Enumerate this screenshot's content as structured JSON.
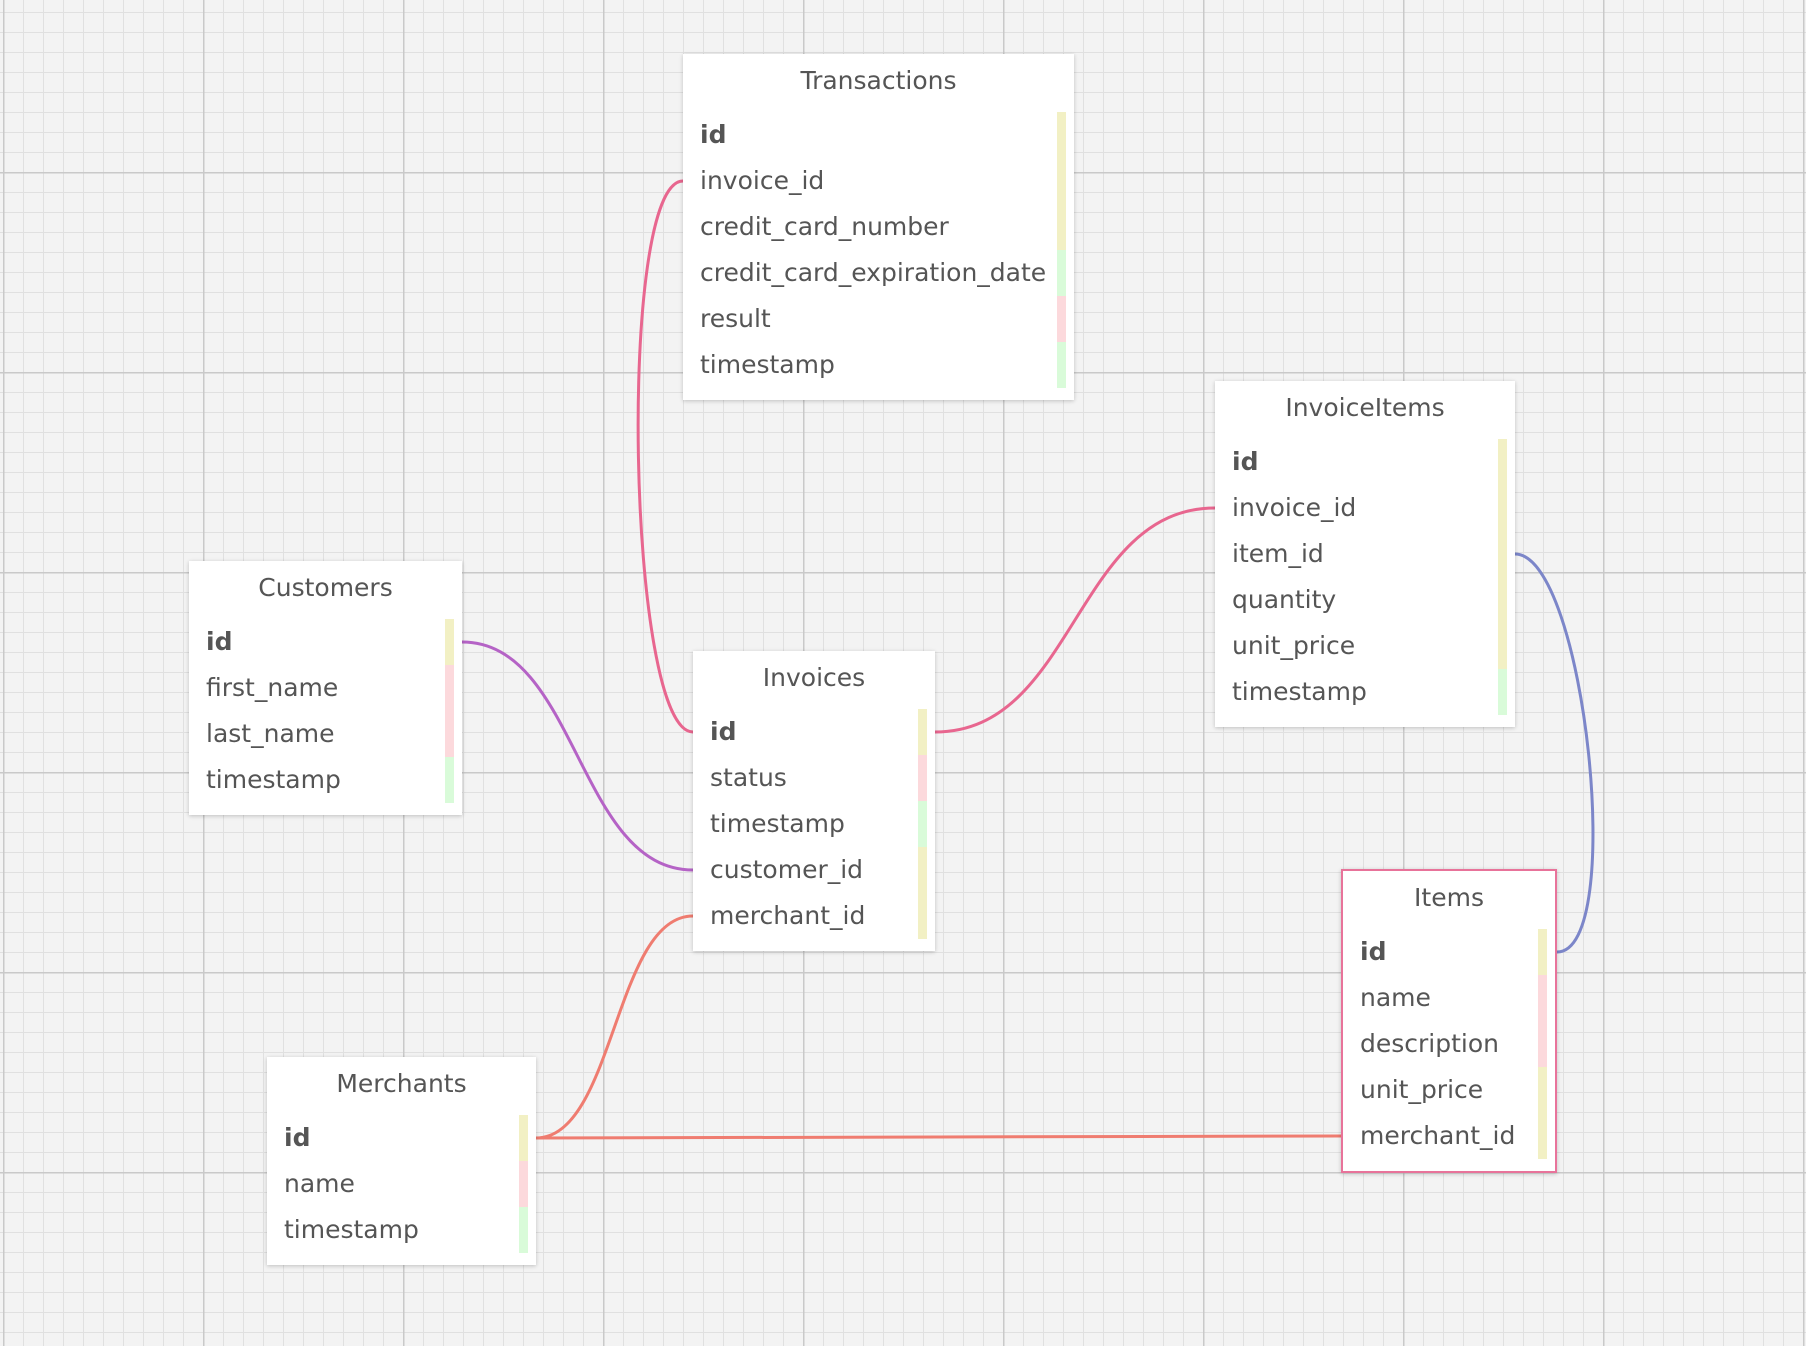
{
  "type_colors": {
    "integer": "#f2f0c4",
    "string": "#fcd9dc",
    "timestamp": "#d9fbd9"
  },
  "tables": [
    {
      "id": "transactions",
      "title": "Transactions",
      "fields": [
        {
          "name": "id",
          "key": true,
          "type": "integer"
        },
        {
          "name": "invoice_id",
          "type": "integer"
        },
        {
          "name": "credit_card_number",
          "type": "integer"
        },
        {
          "name": "credit_card_expiration_date",
          "type": "timestamp"
        },
        {
          "name": "result",
          "type": "string"
        },
        {
          "name": "timestamp",
          "type": "timestamp"
        }
      ]
    },
    {
      "id": "invoiceitems",
      "title": "InvoiceItems",
      "fields": [
        {
          "name": "id",
          "key": true,
          "type": "integer"
        },
        {
          "name": "invoice_id",
          "type": "integer"
        },
        {
          "name": "item_id",
          "type": "integer"
        },
        {
          "name": "quantity",
          "type": "integer"
        },
        {
          "name": "unit_price",
          "type": "integer"
        },
        {
          "name": "timestamp",
          "type": "timestamp"
        }
      ]
    },
    {
      "id": "customers",
      "title": "Customers",
      "fields": [
        {
          "name": "id",
          "key": true,
          "type": "integer"
        },
        {
          "name": "first_name",
          "type": "string"
        },
        {
          "name": "last_name",
          "type": "string"
        },
        {
          "name": "timestamp",
          "type": "timestamp"
        }
      ]
    },
    {
      "id": "invoices",
      "title": "Invoices",
      "fields": [
        {
          "name": "id",
          "key": true,
          "type": "integer"
        },
        {
          "name": "status",
          "type": "string"
        },
        {
          "name": "timestamp",
          "type": "timestamp"
        },
        {
          "name": "customer_id",
          "type": "integer"
        },
        {
          "name": "merchant_id",
          "type": "integer"
        }
      ]
    },
    {
      "id": "items",
      "title": "Items",
      "selected": true,
      "fields": [
        {
          "name": "id",
          "key": true,
          "type": "integer"
        },
        {
          "name": "name",
          "type": "string"
        },
        {
          "name": "description",
          "type": "string"
        },
        {
          "name": "unit_price",
          "type": "integer"
        },
        {
          "name": "merchant_id",
          "type": "integer"
        }
      ]
    },
    {
      "id": "merchants",
      "title": "Merchants",
      "fields": [
        {
          "name": "id",
          "key": true,
          "type": "integer"
        },
        {
          "name": "name",
          "type": "string"
        },
        {
          "name": "timestamp",
          "type": "timestamp"
        }
      ]
    }
  ],
  "relations": [
    {
      "from": [
        "transactions",
        "invoice_id"
      ],
      "to": [
        "invoices",
        "id"
      ],
      "color": "#e8668f"
    },
    {
      "from": [
        "customers",
        "id"
      ],
      "to": [
        "invoices",
        "customer_id"
      ],
      "color": "#b563c6"
    },
    {
      "from": [
        "invoices",
        "id"
      ],
      "to": [
        "invoiceitems",
        "invoice_id"
      ],
      "color": "#e8668f"
    },
    {
      "from": [
        "invoiceitems",
        "item_id"
      ],
      "to": [
        "items",
        "id"
      ],
      "color": "#7c86c9"
    },
    {
      "from": [
        "merchants",
        "id"
      ],
      "to": [
        "invoices",
        "merchant_id"
      ],
      "color": "#ef7c70"
    },
    {
      "from": [
        "merchants",
        "id"
      ],
      "to": [
        "items",
        "merchant_id"
      ],
      "color": "#ef7c70"
    }
  ]
}
